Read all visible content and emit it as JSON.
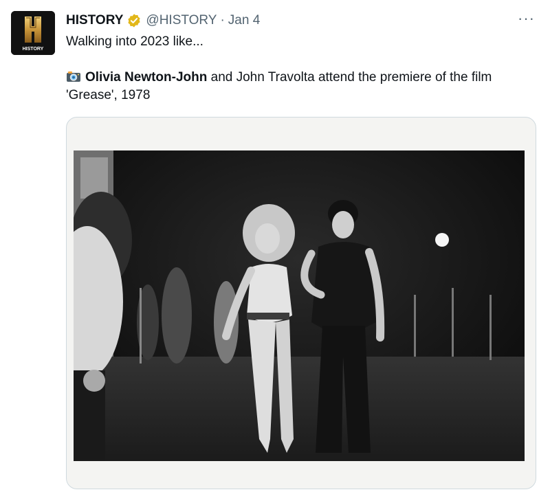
{
  "tweet": {
    "author_name": "HISTORY",
    "handle": "@HISTORY",
    "separator": "·",
    "date": "Jan 4",
    "text": "Walking into 2023 like...",
    "caption_bold": "Olivia Newton-John",
    "caption_rest": " and John Travolta attend the premiere of the film 'Grease', 1978",
    "more_label": "···"
  },
  "avatar": {
    "logo_letter": "H",
    "logo_text": "HISTORY"
  },
  "colors": {
    "text_primary": "#0f1419",
    "text_secondary": "#536471",
    "verified_badge": "#e2b719",
    "border": "#cfd9de"
  },
  "icons": [
    "verified-badge-icon",
    "camera-icon",
    "more-icon"
  ]
}
